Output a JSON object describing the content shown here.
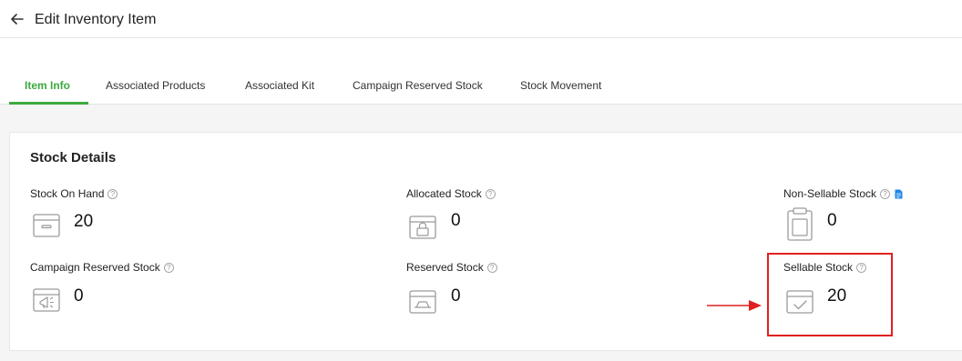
{
  "header": {
    "title": "Edit Inventory Item"
  },
  "tabs": [
    {
      "label": "Item Info"
    },
    {
      "label": "Associated Products"
    },
    {
      "label": "Associated Kit"
    },
    {
      "label": "Campaign Reserved Stock"
    },
    {
      "label": "Stock Movement"
    }
  ],
  "active_tab": "Item Info",
  "section": {
    "title": "Stock Details"
  },
  "stats": {
    "on_hand": {
      "label": "Stock On Hand",
      "value": "20",
      "icon": "box-icon"
    },
    "allocated": {
      "label": "Allocated Stock",
      "value": "0",
      "icon": "lock-box-icon"
    },
    "non_sellable": {
      "label": "Non-Sellable Stock",
      "value": "0",
      "icon": "clipboard-icon"
    },
    "campaign_reserved": {
      "label": "Campaign Reserved Stock",
      "value": "0",
      "icon": "megaphone-icon"
    },
    "reserved": {
      "label": "Reserved Stock",
      "value": "0",
      "icon": "tray-box-icon"
    },
    "sellable": {
      "label": "Sellable Stock",
      "value": "20",
      "icon": "check-box-icon"
    }
  },
  "colors": {
    "accent": "#3caa3f",
    "annotation": "#e0201f",
    "link": "#1e88e5"
  }
}
